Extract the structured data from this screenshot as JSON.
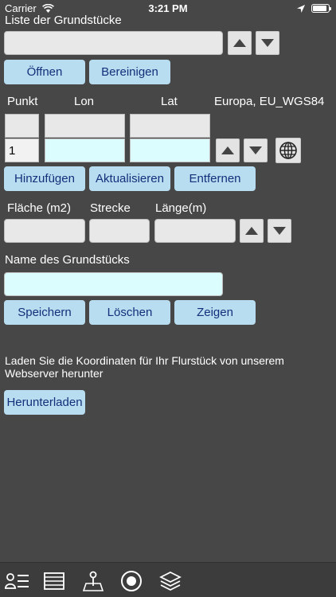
{
  "status_bar": {
    "carrier": "Carrier",
    "time": "3:21 PM"
  },
  "parcel_list": {
    "label": "Liste der Grundstücke",
    "selected": ""
  },
  "buttons": {
    "open": "Öffnen",
    "clean": "Bereinigen",
    "add": "Hinzufügen",
    "update": "Aktualisieren",
    "remove": "Entfernen",
    "save": "Speichern",
    "delete": "Löschen",
    "show": "Zeigen",
    "download": "Herunterladen"
  },
  "points": {
    "headers": {
      "point": "Punkt",
      "lon": "Lon",
      "lat": "Lat",
      "datum": "Europa, EU_WGS84"
    },
    "previous": {
      "point": "",
      "lon": "",
      "lat": ""
    },
    "current": {
      "point": "1",
      "lon": "",
      "lat": ""
    }
  },
  "measures": {
    "area_label": "Fläche (m2)",
    "segment_label": "Strecke",
    "length_label": "Länge(m)",
    "area": "",
    "segment": "",
    "length": ""
  },
  "parcel_name": {
    "label": "Name des Grundstücks",
    "value": ""
  },
  "download_note": "Laden Sie die Koordinaten für Ihr Flurstück von unserem Webserver herunter",
  "tabs": [
    {
      "icon": "contacts-list-icon"
    },
    {
      "icon": "table-list-icon"
    },
    {
      "icon": "map-pin-icon"
    },
    {
      "icon": "record-icon"
    },
    {
      "icon": "layers-icon"
    }
  ]
}
